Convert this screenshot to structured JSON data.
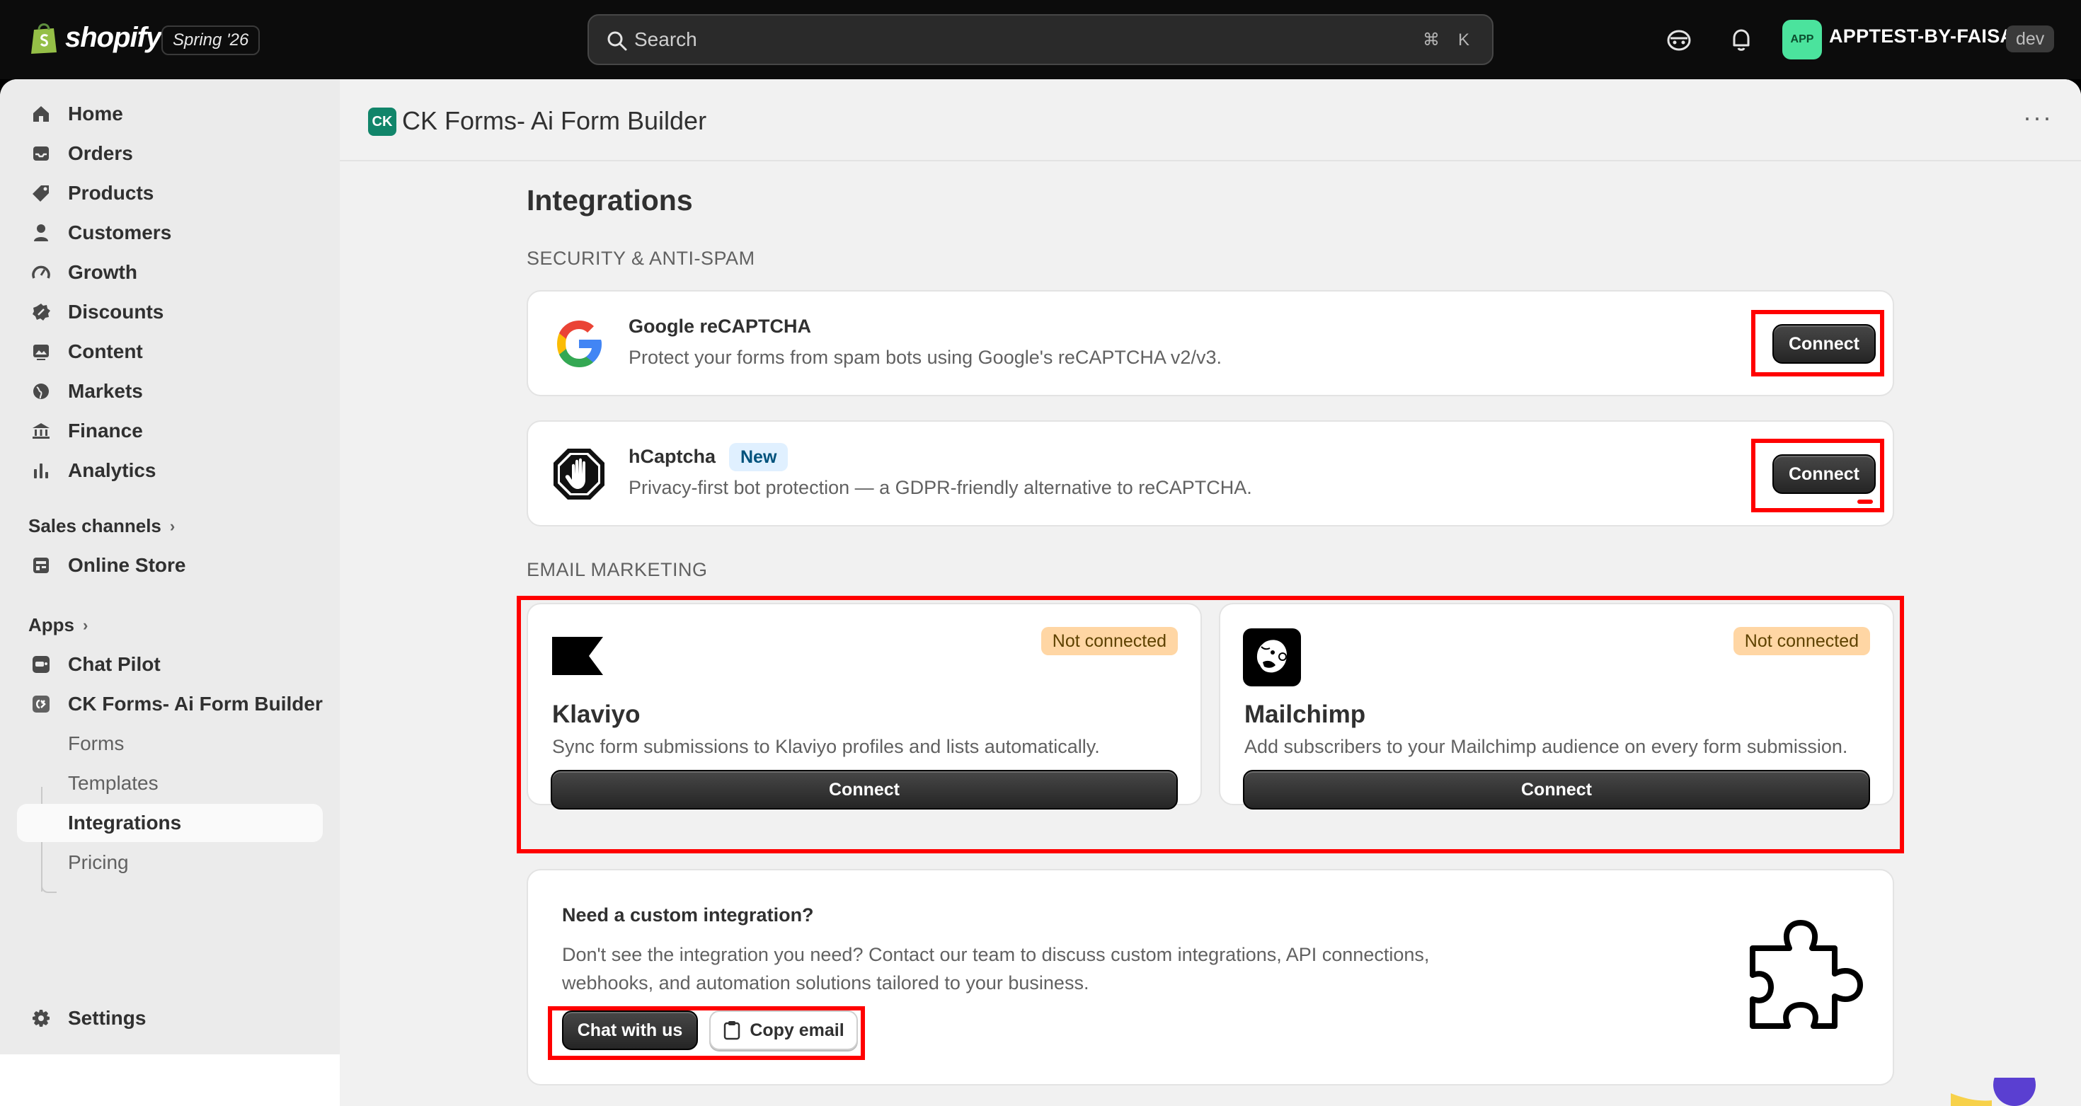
{
  "topbar": {
    "brand": "shopify",
    "season_badge": "Spring '26",
    "search_placeholder": "Search",
    "shortcut_cmd": "⌘",
    "shortcut_key": "K",
    "avatar_initials": "APP",
    "store_name": "APPTEST-BY-FAISAL",
    "env_badge": "dev"
  },
  "sidebar": {
    "items": [
      {
        "label": "Home",
        "icon": "home-icon"
      },
      {
        "label": "Orders",
        "icon": "inbox-icon"
      },
      {
        "label": "Products",
        "icon": "tag-icon"
      },
      {
        "label": "Customers",
        "icon": "person-icon"
      },
      {
        "label": "Growth",
        "icon": "gauge-icon"
      },
      {
        "label": "Discounts",
        "icon": "discount-icon"
      },
      {
        "label": "Content",
        "icon": "image-icon"
      },
      {
        "label": "Markets",
        "icon": "globe-icon"
      },
      {
        "label": "Finance",
        "icon": "bank-icon"
      },
      {
        "label": "Analytics",
        "icon": "bar-chart-icon"
      }
    ],
    "sales_channels_label": "Sales channels",
    "online_store_label": "Online Store",
    "apps_label": "Apps",
    "chat_pilot_label": "Chat Pilot",
    "ck_forms_label": "CK Forms- Ai Form Builder",
    "sub_items": [
      "Forms",
      "Templates",
      "Integrations",
      "Pricing"
    ],
    "active_sub": "Integrations",
    "settings_label": "Settings"
  },
  "app_header": {
    "logo_text": "CK",
    "title": "CK Forms- Ai Form Builder",
    "more": "···"
  },
  "page": {
    "title": "Integrations",
    "security_group": "SECURITY & ANTI-SPAM",
    "email_group": "EMAIL MARKETING"
  },
  "recaptcha": {
    "title": "Google reCAPTCHA",
    "description": "Protect your forms from spam bots using Google's reCAPTCHA v2/v3.",
    "button": "Connect"
  },
  "hcaptcha": {
    "title": "hCaptcha",
    "badge": "New",
    "description": "Privacy-first bot protection — a GDPR-friendly alternative to reCAPTCHA.",
    "button": "Connect"
  },
  "klaviyo": {
    "status": "Not connected",
    "title": "Klaviyo",
    "description": "Sync form submissions to Klaviyo profiles and lists automatically.",
    "button": "Connect"
  },
  "mailchimp": {
    "status": "Not connected",
    "title": "Mailchimp",
    "description": "Add subscribers to your Mailchimp audience on every form submission.",
    "button": "Connect"
  },
  "custom": {
    "title": "Need a custom integration?",
    "description_line1": "Don't see the integration you need? Contact our team to discuss custom integrations, API connections,",
    "description_line2": "webhooks, and automation solutions tailored to your business.",
    "chat_button": "Chat with us",
    "copy_button": "Copy email"
  },
  "colors": {
    "highlight": "#ff0000",
    "primary_button": "#303030",
    "badge_new_bg": "#e0f0ff",
    "badge_warn_bg": "#ffd6a4",
    "avatar_bg": "#4be39d"
  }
}
